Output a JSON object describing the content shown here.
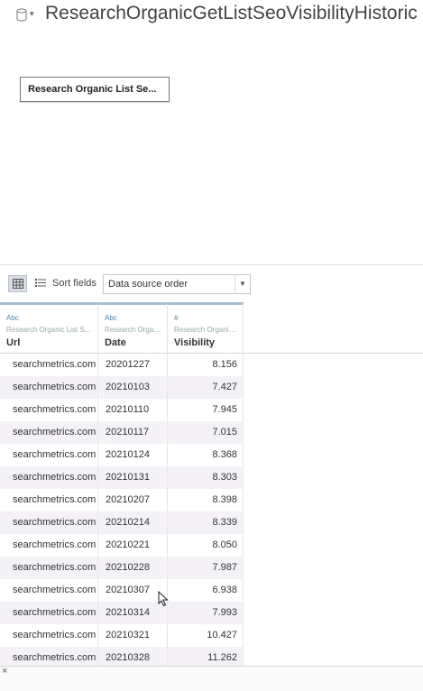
{
  "header": {
    "title": "ResearchOrganicGetListSeoVisibilityHistoric",
    "caret": "▾"
  },
  "canvas": {
    "table_card_label": "Research Organic List Se..."
  },
  "toolbar": {
    "sort_label": "Sort fields",
    "sort_value": "Data source order"
  },
  "columns": [
    {
      "type": "Abc",
      "source": "Research Organic List S...",
      "name": "Url"
    },
    {
      "type": "Abc",
      "source": "Research Organi...",
      "name": "Date"
    },
    {
      "type": "#",
      "source": "Research Organic ...",
      "name": "Visibility"
    }
  ],
  "rows": [
    {
      "url": "searchmetrics.com",
      "date": "20201227",
      "visibility": "8.156"
    },
    {
      "url": "searchmetrics.com",
      "date": "20210103",
      "visibility": "7.427"
    },
    {
      "url": "searchmetrics.com",
      "date": "20210110",
      "visibility": "7.945"
    },
    {
      "url": "searchmetrics.com",
      "date": "20210117",
      "visibility": "7.015"
    },
    {
      "url": "searchmetrics.com",
      "date": "20210124",
      "visibility": "8.368"
    },
    {
      "url": "searchmetrics.com",
      "date": "20210131",
      "visibility": "8.303"
    },
    {
      "url": "searchmetrics.com",
      "date": "20210207",
      "visibility": "8.398"
    },
    {
      "url": "searchmetrics.com",
      "date": "20210214",
      "visibility": "8.339"
    },
    {
      "url": "searchmetrics.com",
      "date": "20210221",
      "visibility": "8.050"
    },
    {
      "url": "searchmetrics.com",
      "date": "20210228",
      "visibility": "7.987"
    },
    {
      "url": "searchmetrics.com",
      "date": "20210307",
      "visibility": "6.938"
    },
    {
      "url": "searchmetrics.com",
      "date": "20210314",
      "visibility": "7.993"
    },
    {
      "url": "searchmetrics.com",
      "date": "20210321",
      "visibility": "10.427"
    },
    {
      "url": "searchmetrics.com",
      "date": "20210328",
      "visibility": "11.262"
    }
  ],
  "bottom": {
    "close_glyph": "×"
  },
  "icons": {
    "datasource": "database-icon",
    "grid_view": "grid-view-icon",
    "list_view": "list-view-icon",
    "cursor": "mouse-cursor-icon"
  },
  "colors": {
    "header_accent": "#a6bfd0",
    "type_icon": "#4a86a8",
    "alt_row": "#f5f2f7"
  }
}
